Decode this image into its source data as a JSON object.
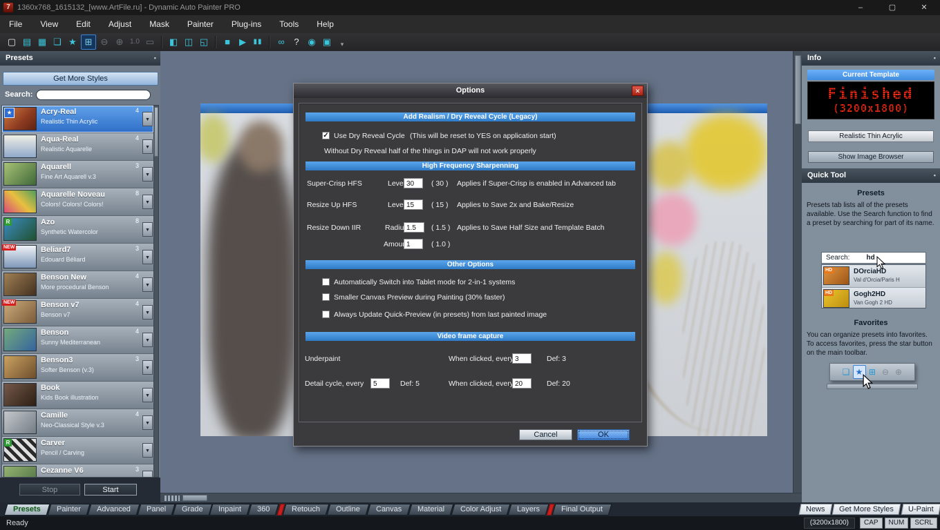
{
  "ui": {
    "dropdown_glyph": "▼",
    "check_glyph": "✓",
    "star_glyph": "★",
    "pin_glyph": "▪",
    "new_badge": "NEW"
  },
  "window": {
    "logo": "7",
    "title": "1360x768_1615132_[www.ArtFile.ru] - Dynamic Auto Painter PRO",
    "minimize": "–",
    "maximize": "▢",
    "close": "✕"
  },
  "menubar": {
    "items": [
      "File",
      "View",
      "Edit",
      "Adjust",
      "Mask",
      "Painter",
      "Plug-ins",
      "Tools",
      "Help"
    ]
  },
  "toolbar": {
    "icons": [
      {
        "name": "new-file",
        "glyph": "▢"
      },
      {
        "name": "open-folder",
        "glyph": "▤"
      },
      {
        "name": "save",
        "glyph": "▦"
      },
      {
        "name": "copy",
        "glyph": "❏"
      },
      {
        "name": "favorites-star",
        "glyph": "★"
      },
      {
        "name": "preset-browser",
        "glyph": "⊞"
      },
      {
        "name": "zoom-out",
        "glyph": "⊖"
      },
      {
        "name": "zoom-in",
        "glyph": "⊕"
      },
      {
        "name": "zoom-level",
        "glyph": "1.0"
      },
      {
        "name": "fit-view",
        "glyph": "▭"
      },
      {
        "name": "frame",
        "glyph": "◧"
      },
      {
        "name": "split-view",
        "glyph": "◫"
      },
      {
        "name": "crop",
        "glyph": "◱"
      },
      {
        "name": "stop",
        "glyph": "■"
      },
      {
        "name": "play",
        "glyph": "▶"
      },
      {
        "name": "pause",
        "glyph": "▮▮"
      },
      {
        "name": "stereo-3d",
        "glyph": "∞"
      },
      {
        "name": "help",
        "glyph": "?"
      },
      {
        "name": "quick-preview",
        "glyph": "◉"
      },
      {
        "name": "fullscreen",
        "glyph": "▣"
      },
      {
        "name": "overflow",
        "glyph": "▾"
      }
    ]
  },
  "presets_panel": {
    "title": "Presets",
    "get_more_styles": "Get More Styles",
    "search_label": "Search:",
    "search_value": "",
    "stop": "Stop",
    "start": "Start",
    "items": [
      {
        "name": "Acry-Real",
        "subtitle": "Realistic Thin Acrylic",
        "badge": "4"
      },
      {
        "name": "Aqua-Real",
        "subtitle": "Realistic Aquarelle",
        "badge": "4"
      },
      {
        "name": "Aquarell",
        "subtitle": "Fine Art Aquarell v.3",
        "badge": "3"
      },
      {
        "name": "Aquarelle Noveau",
        "subtitle": "Colors! Colors! Colors!",
        "badge": "8"
      },
      {
        "name": "Azo",
        "subtitle": "Synthetic Watercolor",
        "badge": "8",
        "corner": "R"
      },
      {
        "name": "Beliard7",
        "subtitle": "Edouard Béliard",
        "badge": "3"
      },
      {
        "name": "Benson New",
        "subtitle": "More procedural Benson",
        "badge": "4"
      },
      {
        "name": "Benson v7",
        "subtitle": "Benson v7",
        "badge": "4"
      },
      {
        "name": "Benson",
        "subtitle": "Sunny Mediterranean",
        "badge": "4"
      },
      {
        "name": "Benson3",
        "subtitle": "Softer Benson (v.3)",
        "badge": "3"
      },
      {
        "name": "Book",
        "subtitle": "Kids Book illustration",
        "badge": ""
      },
      {
        "name": "Camille",
        "subtitle": "Neo-Classical Style v.3",
        "badge": "4"
      },
      {
        "name": "Carver",
        "subtitle": "Pencil / Carving",
        "badge": "",
        "corner": "R"
      },
      {
        "name": "Cezanne V6",
        "subtitle": "",
        "badge": "3"
      }
    ]
  },
  "dialog": {
    "title": "Options",
    "realism_header": "Add Realism / Dry Reveal Cycle  (Legacy)",
    "dry_reveal_label": "Use Dry Reveal Cycle",
    "dry_reveal_note": "(This will be reset to YES on application start)",
    "dry_reveal_warning": "Without Dry Reveal half of the things in DAP will not work properly",
    "hfs_header": "High Frequency Sharpenning",
    "rows": [
      {
        "label": "Super-Crisp HFS",
        "param": "Level",
        "value": "30",
        "default": "( 30 )",
        "note": "Applies if Super-Crisp is enabled in Advanced tab"
      },
      {
        "label": "Resize Up HFS",
        "param": "Level",
        "value": "15",
        "default": "( 15 )",
        "note": "Applies to Save 2x and Bake/Resize"
      },
      {
        "label": "Resize Down IIR",
        "param": "Radius",
        "value": "1.5",
        "default": "( 1.5 )",
        "note": "Applies to Save Half Size and Template Batch"
      },
      {
        "label": "",
        "param": "Amount",
        "value": "1",
        "default": "( 1.0 )",
        "note": ""
      }
    ],
    "other_header": "Other Options",
    "checkboxes": [
      "Automatically Switch into Tablet mode for 2-in-1 systems",
      "Smaller Canvas Preview during Painting (30% faster)",
      "Always Update Quick-Preview (in presets) from last painted image"
    ],
    "video_header": "Video frame capture",
    "underpaint_label": "Underpaint",
    "underpaint_when": "When clicked, every",
    "underpaint_value": "3",
    "underpaint_def": "Def: 3",
    "detail_label": "Detail cycle, every",
    "detail_value": "5",
    "detail_def": "Def: 5",
    "detail_when": "When clicked, every",
    "detail_when_value": "20",
    "detail_when_def": "Def: 20",
    "cancel": "Cancel",
    "ok": "OK"
  },
  "info_panel": {
    "title": "Info",
    "current_template": "Current Template",
    "led_line1": "Finished",
    "led_line2": "(3200x1800)",
    "template_name": "Realistic Thin Acrylic",
    "show_browser": "Show Image Browser"
  },
  "quick_tool": {
    "title": "Quick Tool",
    "presets_heading": "Presets",
    "presets_text": "Presets tab lists all of the presets available. Use the Search function to find a preset by searching for part of its name.",
    "search_label": "Search:",
    "search_value": "hd",
    "results": [
      {
        "name": "DOrciaHD",
        "subtitle": "Val d'Orcia/Paris H",
        "badge": "HD"
      },
      {
        "name": "Gogh2HD",
        "subtitle": "Van Gogh 2 HD",
        "badge": "HD"
      }
    ],
    "favorites_heading": "Favorites",
    "favorites_text": "You can organize presets into favorites. To access favorites, press the star button on the main toolbar.",
    "fav_icons": [
      {
        "name": "copy",
        "glyph": "❏"
      },
      {
        "name": "favorites-star",
        "glyph": "★"
      },
      {
        "name": "preset-browser",
        "glyph": "⊞"
      },
      {
        "name": "zoom-out",
        "glyph": "⊖"
      },
      {
        "name": "zoom-in",
        "glyph": "⊕"
      }
    ]
  },
  "tabbar": {
    "tabs": [
      "Presets",
      "Painter",
      "Advanced",
      "Panel",
      "Grade",
      "Inpaint",
      "360",
      "Retouch",
      "Outline",
      "Canvas",
      "Material",
      "Color Adjust",
      "Layers",
      "Final Output"
    ],
    "selected": "Presets",
    "right_tabs": [
      "News",
      "Get More Styles",
      "U-Paint"
    ]
  },
  "statusbar": {
    "left": "Ready",
    "size": "(3200x1800)",
    "toggles": [
      "CAP",
      "NUM",
      "SCRL"
    ]
  }
}
